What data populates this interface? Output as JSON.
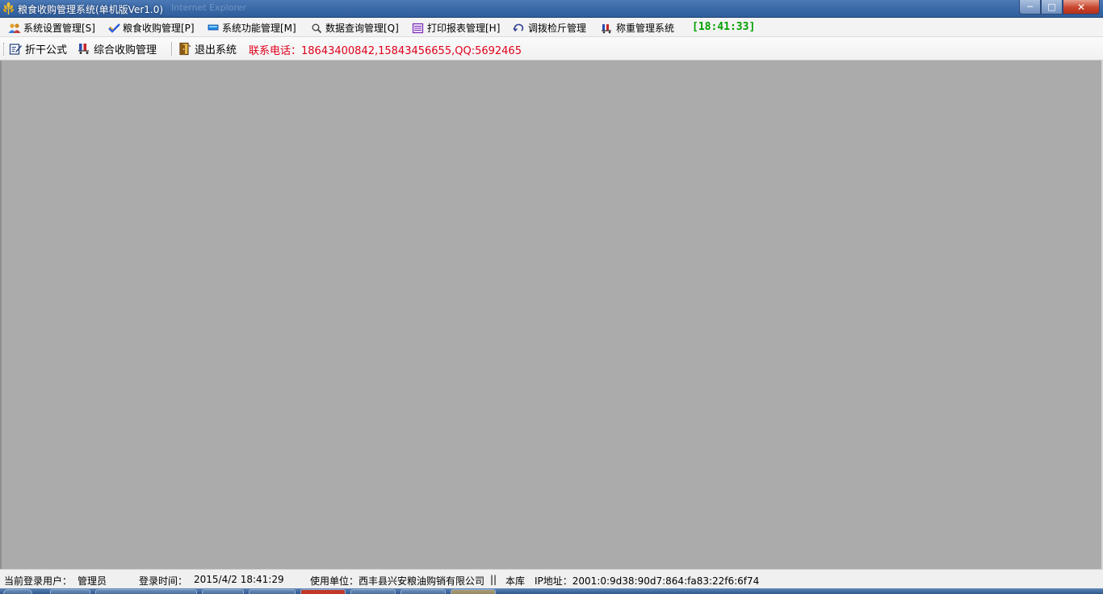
{
  "window": {
    "title": "粮食收购管理系统(单机版Ver1.0)",
    "ghost_title": "Internet Explorer",
    "minimize": "─",
    "maximize": "□",
    "close": "✕"
  },
  "menu": {
    "items": [
      {
        "label": "系统设置管理[S]",
        "icon": "users-icon"
      },
      {
        "label": "粮食收购管理[P]",
        "icon": "grain-check-icon"
      },
      {
        "label": "系统功能管理[M]",
        "icon": "monitor-icon"
      },
      {
        "label": "数据查询管理[Q]",
        "icon": "magnifier-icon"
      },
      {
        "label": "打印报表管理[H]",
        "icon": "report-icon"
      },
      {
        "label": "调拨检斤管理",
        "icon": "transfer-icon"
      },
      {
        "label": "称重管理系统",
        "icon": "scale-cart-icon"
      }
    ],
    "clock": "[18:41:33]"
  },
  "toolbar": {
    "items": [
      {
        "label": "折干公式",
        "icon": "edit-formula-icon"
      },
      {
        "label": "综合收购管理",
        "icon": "scale-cart-icon"
      },
      {
        "label": "退出系统",
        "icon": "exit-door-icon"
      }
    ],
    "contact": "联系电话：18643400842,15843456655,QQ:5692465"
  },
  "status": {
    "user_label": "当前登录用户：",
    "user_value": "管理员",
    "login_label": "登录时间：",
    "login_value": "2015/4/2 18:41:29",
    "unit_label": "使用单位：西丰县兴安粮油购销有限公司",
    "separator": "||",
    "db": "本库",
    "ip": "IP地址：2001:0:9d38:90d7:864:fa83:22f6:6f74"
  },
  "colors": {
    "workspace": "#ababab",
    "clock": "#00a000",
    "contact": "#e0001b",
    "titlebar": "#3b6aa8"
  }
}
